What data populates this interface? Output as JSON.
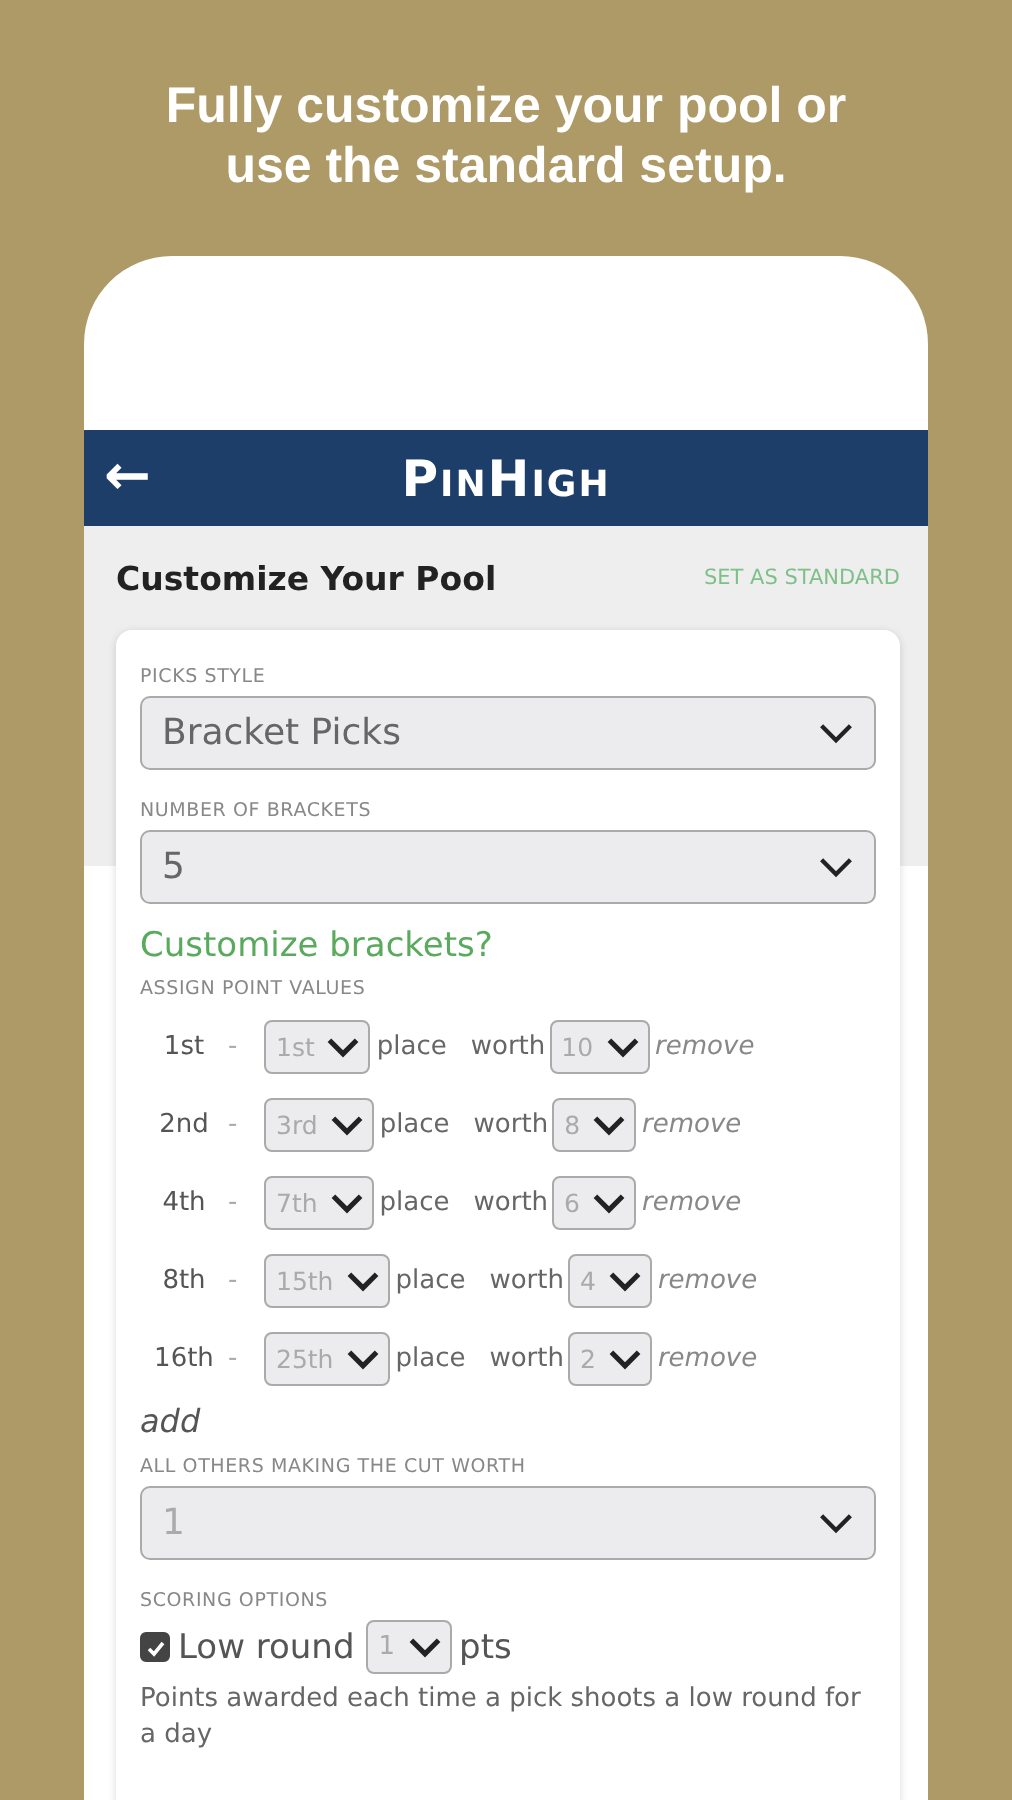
{
  "headline": "Fully customize your pool or use the standard setup.",
  "app_bar": {
    "back_icon": "←",
    "logo": "PinHigh"
  },
  "page": {
    "title": "Customize Your Pool",
    "action": "SET AS STANDARD"
  },
  "picks_style": {
    "label": "PICKS STYLE",
    "value": "Bracket Picks"
  },
  "brackets": {
    "label": "NUMBER OF BRACKETS",
    "value": "5"
  },
  "customize_link": "Customize brackets?",
  "assign": {
    "label": "ASSIGN POINT VALUES",
    "rows": [
      {
        "rank": "1st",
        "dash": "-",
        "place": "1st",
        "place_word": "place",
        "worth_word": "worth",
        "points": "10",
        "remove": "remove"
      },
      {
        "rank": "2nd",
        "dash": "-",
        "place": "3rd",
        "place_word": "place",
        "worth_word": "worth",
        "points": "8",
        "remove": "remove"
      },
      {
        "rank": "4th",
        "dash": "-",
        "place": "7th",
        "place_word": "place",
        "worth_word": "worth",
        "points": "6",
        "remove": "remove"
      },
      {
        "rank": "8th",
        "dash": "-",
        "place": "15th",
        "place_word": "place",
        "worth_word": "worth",
        "points": "4",
        "remove": "remove"
      },
      {
        "rank": "16th",
        "dash": "-",
        "place": "25th",
        "place_word": "place",
        "worth_word": "worth",
        "points": "2",
        "remove": "remove"
      }
    ],
    "add": "add"
  },
  "others": {
    "label": "ALL OTHERS MAKING THE CUT WORTH",
    "value": "1"
  },
  "scoring": {
    "label": "SCORING OPTIONS",
    "low_round": {
      "checked": true,
      "label": "Low round",
      "value": "1",
      "unit": "pts",
      "help": "Points awarded each time a pick shoots a low round for a day"
    }
  }
}
